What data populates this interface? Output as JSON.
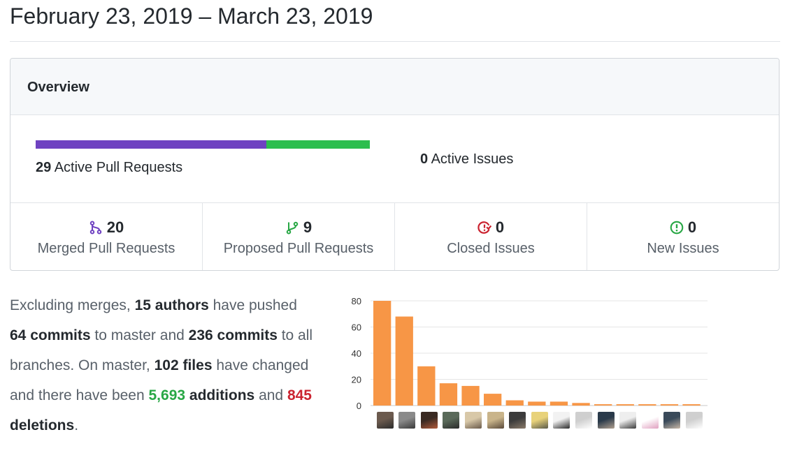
{
  "page": {
    "title": "February 23, 2019 – March 23, 2019"
  },
  "overview": {
    "heading": "Overview",
    "pull_requests": {
      "count": "29",
      "label": "Active Pull Requests",
      "merged_fraction": 0.69,
      "colors": {
        "merged": "#6f42c1",
        "proposed": "#2cbe4e"
      }
    },
    "issues": {
      "count": "0",
      "label": "Active Issues"
    },
    "stats": [
      {
        "icon": "merged-pr-icon",
        "value": "20",
        "label": "Merged Pull Requests",
        "color": "#6f42c1"
      },
      {
        "icon": "proposed-pr-icon",
        "value": "9",
        "label": "Proposed Pull Requests",
        "color": "#28a745"
      },
      {
        "icon": "closed-issue-icon",
        "value": "0",
        "label": "Closed Issues",
        "color": "#cb2431"
      },
      {
        "icon": "new-issue-icon",
        "value": "0",
        "label": "New Issues",
        "color": "#28a745"
      }
    ]
  },
  "summary": {
    "t1": "Excluding merges, ",
    "authors": "15 authors",
    "t2": " have pushed ",
    "commits_master": "64 commits",
    "t3": " to master and ",
    "commits_all": "236 commits",
    "t4": " to all branches. On master, ",
    "files": "102 files",
    "t5": " have changed and there have been ",
    "additions_num": "5,693",
    "additions_word": " additions",
    "t6": " and ",
    "deletions_num": "845",
    "deletions_word": " deletions",
    "t7": "."
  },
  "chart_data": {
    "type": "bar",
    "values": [
      80,
      68,
      30,
      17,
      15,
      9,
      4,
      3,
      3,
      2,
      1,
      1,
      1,
      1,
      1
    ],
    "ylim": [
      0,
      80
    ],
    "yticks": [
      "0",
      "20",
      "40",
      "60",
      "80"
    ],
    "grid": true,
    "bar_color": "#f79646",
    "categories_are_avatars": true
  }
}
